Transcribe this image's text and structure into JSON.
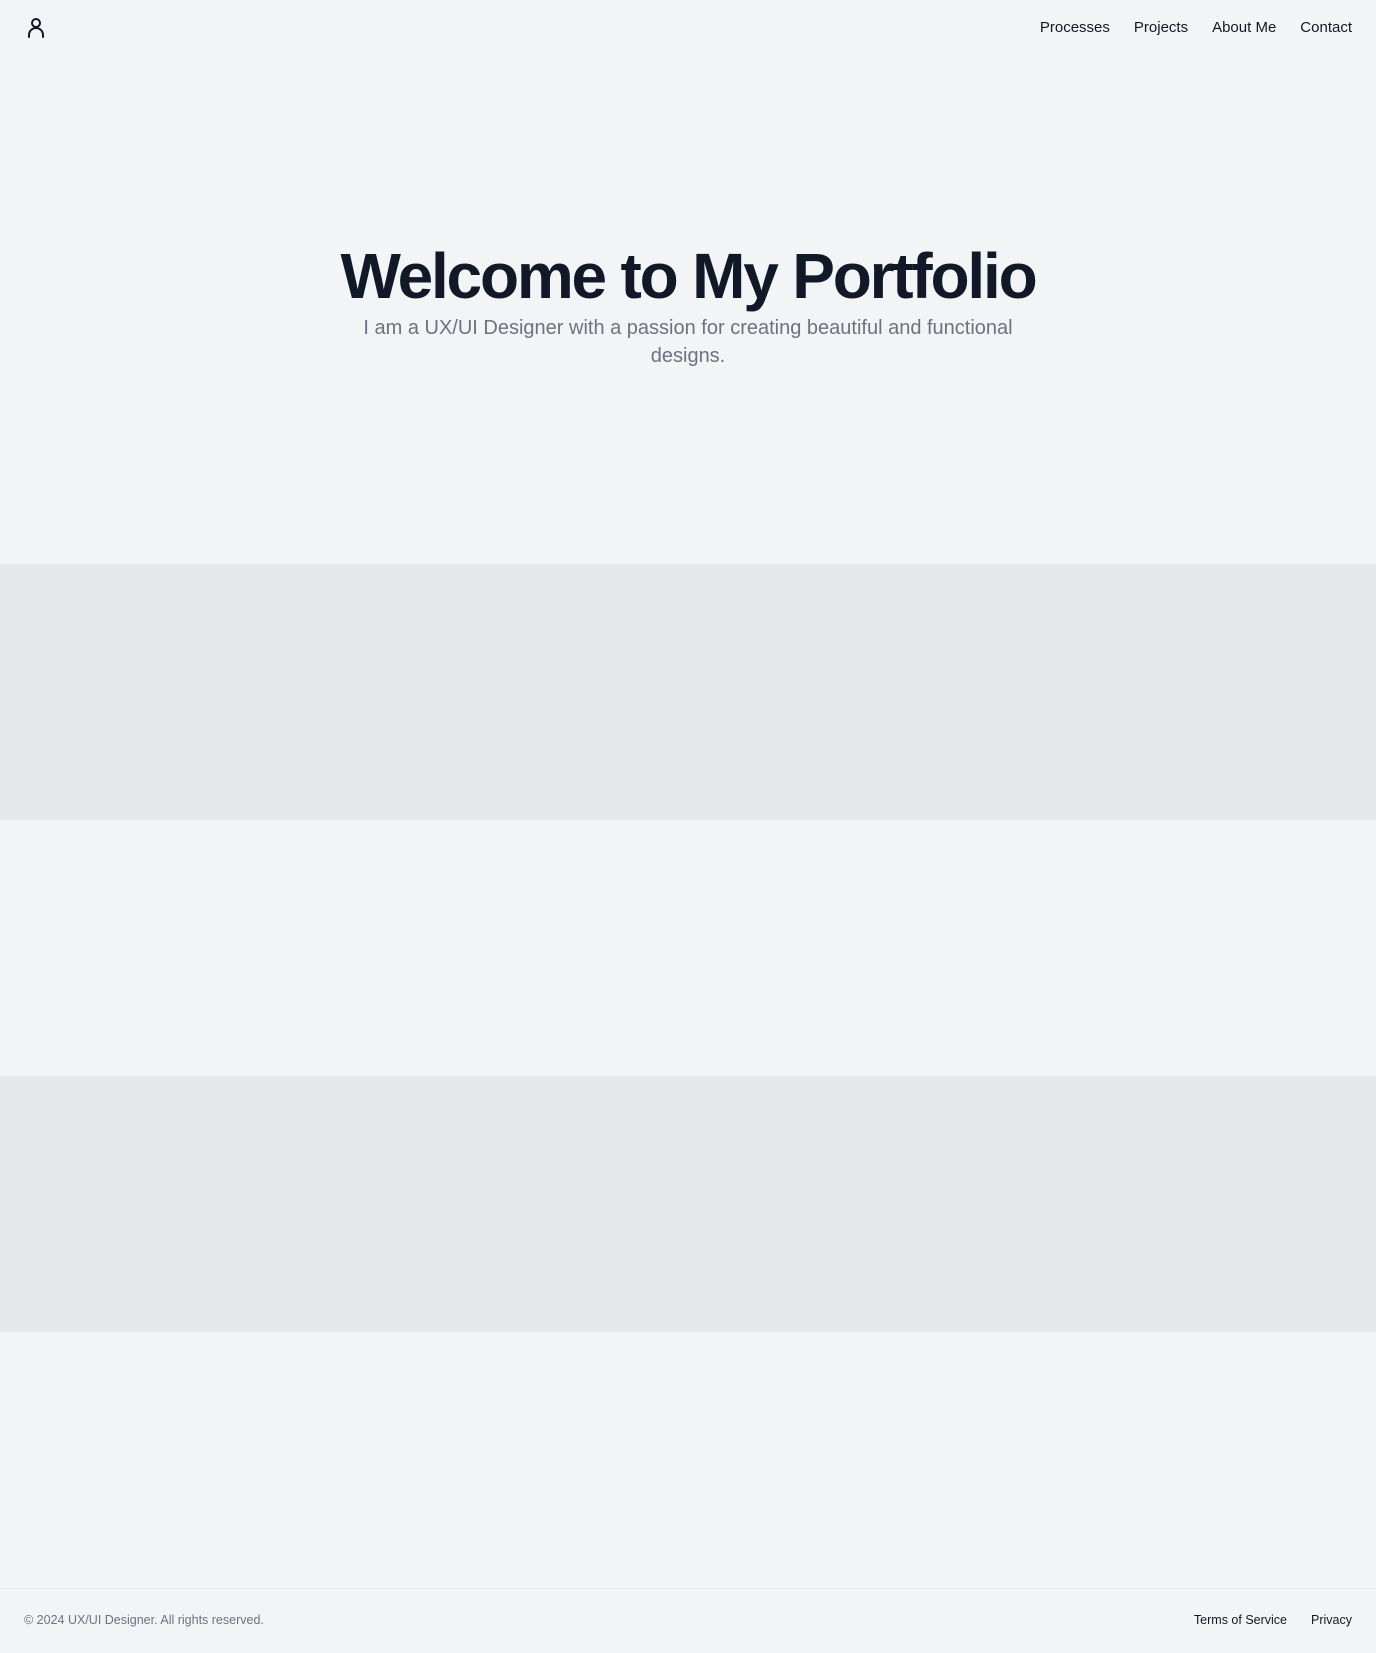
{
  "header": {
    "logo_icon": "user-icon",
    "nav": [
      {
        "label": "Processes"
      },
      {
        "label": "Projects"
      },
      {
        "label": "About Me"
      },
      {
        "label": "Contact"
      }
    ]
  },
  "hero": {
    "title": "Welcome to My Portfolio",
    "subtitle": "I am a UX/UI Designer with a passion for creating beautiful and functional designs."
  },
  "footer": {
    "copyright": "© 2024 UX/UI Designer. All rights reserved.",
    "links": [
      {
        "label": "Terms of Service"
      },
      {
        "label": "Privacy"
      }
    ]
  },
  "colors": {
    "background": "#f3f4f6",
    "section_alt": "#e5e7eb",
    "text_primary": "#111827",
    "text_muted": "#6b7280"
  }
}
